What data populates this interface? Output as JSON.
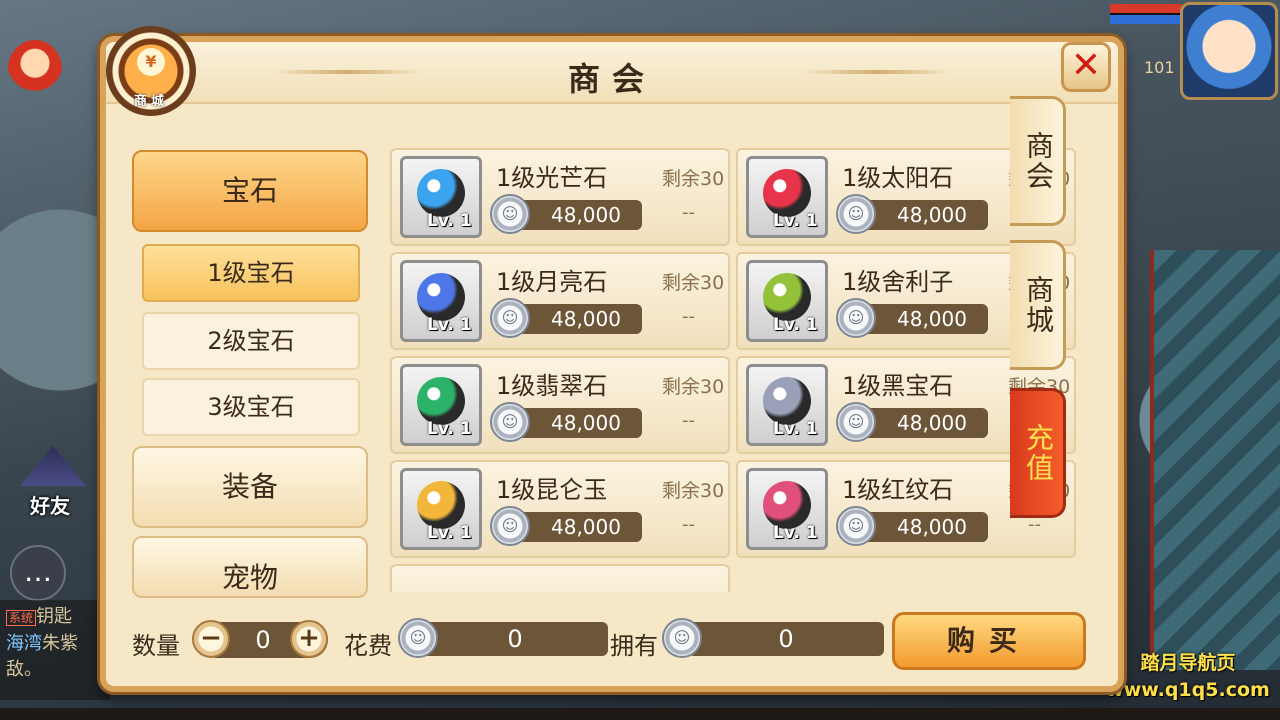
{
  "background": {
    "friend_label": "好友",
    "chat_lines": [
      {
        "sys": "系统",
        "text": "钥匙"
      },
      {
        "text": "海湾",
        "alt": "朱紫"
      },
      {
        "text": "敌。"
      }
    ],
    "level_text": "101",
    "watermark_line1": "踏月导航页",
    "watermark_line2": "www.q1q5.com"
  },
  "panel": {
    "title": "商会",
    "close_icon": "✕",
    "mall_badge_coin": "¥",
    "mall_badge_label": "商城"
  },
  "side_tabs": [
    {
      "label": "商会"
    },
    {
      "label": "商城"
    },
    {
      "label": "充值"
    }
  ],
  "categories": [
    {
      "label": "宝石",
      "active": true
    },
    {
      "label": "装备",
      "active": false
    },
    {
      "label": "宠物",
      "active": false
    }
  ],
  "subcategories": [
    {
      "label": "1级宝石",
      "active": true
    },
    {
      "label": "2级宝石",
      "active": false
    },
    {
      "label": "3级宝石",
      "active": false
    }
  ],
  "items": [
    {
      "name": "1级光芒石",
      "stock": "剩余30",
      "price": "48,000",
      "lv": "Lv. 1",
      "dash": "--",
      "icon": "blue-crystal-icon",
      "color": "#3aa4ef"
    },
    {
      "name": "1级太阳石",
      "stock": "剩余30",
      "price": "48,000",
      "lv": "Lv. 1",
      "dash": "--",
      "icon": "red-swirl-orb-icon",
      "color": "#e8344a"
    },
    {
      "name": "1级月亮石",
      "stock": "剩余30",
      "price": "48,000",
      "lv": "Lv. 1",
      "dash": "--",
      "icon": "blue-crescent-icon",
      "color": "#4d77e8"
    },
    {
      "name": "1级舍利子",
      "stock": "剩余30",
      "price": "48,000",
      "lv": "Lv. 1",
      "dash": "--",
      "icon": "green-beads-icon",
      "color": "#93c23a"
    },
    {
      "name": "1级翡翠石",
      "stock": "剩余30",
      "price": "48,000",
      "lv": "Lv. 1",
      "dash": "--",
      "icon": "green-orb-icon",
      "color": "#2bb36a"
    },
    {
      "name": "1级黑宝石",
      "stock": "剩余30",
      "price": "48,000",
      "lv": "Lv. 1",
      "dash": "--",
      "icon": "silver-diamond-icon",
      "color": "#9aa0b8"
    },
    {
      "name": "1级昆仑玉",
      "stock": "剩余30",
      "price": "48,000",
      "lv": "Lv. 1",
      "dash": "--",
      "icon": "amber-jade-icon",
      "color": "#f2b63a"
    },
    {
      "name": "1级红纹石",
      "stock": "剩余30",
      "price": "48,000",
      "lv": "Lv. 1",
      "dash": "--",
      "icon": "pink-swirl-orb-icon",
      "color": "#e0507a"
    }
  ],
  "footer": {
    "quantity_label": "数量",
    "quantity_value": "0",
    "minus": "−",
    "plus": "+",
    "cost_label": "花费",
    "cost_value": "0",
    "own_label": "拥有",
    "own_value": "0",
    "buy_label": "购买"
  }
}
